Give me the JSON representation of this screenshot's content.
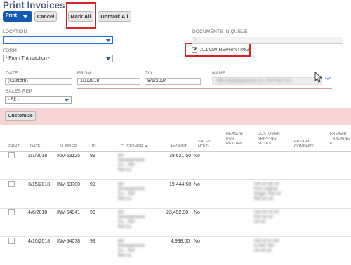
{
  "page": {
    "title": "Print Invoices"
  },
  "toolbar": {
    "print_label": "Print",
    "cancel_label": "Cancel",
    "mark_all_label": "Mark All",
    "unmark_all_label": "Unmark All"
  },
  "form": {
    "location_label": "LOCATION",
    "location_value": "",
    "form_label": "FORM",
    "form_value": "- From Transaction -",
    "documents_in_queue_label": "DOCUMENTS IN QUEUE",
    "documents_in_queue_value": "0",
    "allow_reprinting_label": "ALLOW REPRINTING",
    "allow_reprinting_checked": true,
    "date_label": "DATE",
    "date_value": "(Custom)",
    "from_label": "FROM",
    "from_value": "1/1/2018",
    "to_label": "TO",
    "to_value": "8/1/2024",
    "name_label": "NAME",
    "name_value": "BB Developments Co. Ref Ref Co.",
    "sales_rep_label": "SALES REP",
    "sales_rep_value": "- All -"
  },
  "list": {
    "customize_label": "Customize",
    "columns": {
      "print": "PRINT",
      "date": "DATE",
      "number": "NUMBER",
      "id": "ID",
      "customer": "CUSTOMER ▲",
      "amount": "AMOUNT",
      "sales_hold": "SALES\nHOLD",
      "reason": "REASON\nFOR\nRETURN",
      "shipping_notes": "CUSTOMER\nSHIPPING\nNOTES",
      "freight_company": "FREIGHT\nCOMPANY",
      "freight_tracking": "FREIGHT\nTRACKING\n#"
    },
    "rows": [
      {
        "date": "2/1/2018",
        "number": "INV-53125",
        "id": "99",
        "customer": "BB\nDevelopments\nCo. - Ref\nRef Co.",
        "amount": "39,621.50",
        "hold": "No",
        "notes": ""
      },
      {
        "date": "3/15/2018",
        "number": "INV-53700",
        "id": "99",
        "customer": "BB\nDevelopments\nCo. - Ref\nRef Co.",
        "amount": "19,444.50",
        "hold": "No",
        "notes": "Ref on file ref\nfrom original\nfreight. Ref ref\nRef ref ref."
      },
      {
        "date": "4/6/2018",
        "number": "INV-54041",
        "id": "99",
        "customer": "BB\nDevelopments\nCo. - Ref\nRef Co.",
        "amount": "23,492.90",
        "hold": "No",
        "notes": "Ref ref ref ref\nRef ref ref\nref ref."
      },
      {
        "date": "4/10/2018",
        "number": "INV-54078",
        "id": "99",
        "customer": "BB\nDevelopments\nCo. - Ref\nRef Co.",
        "amount": "4,998.00",
        "hold": "No",
        "notes": "Ref ref to Ref\nto Ref. Ref\nref ref ref."
      }
    ]
  }
}
